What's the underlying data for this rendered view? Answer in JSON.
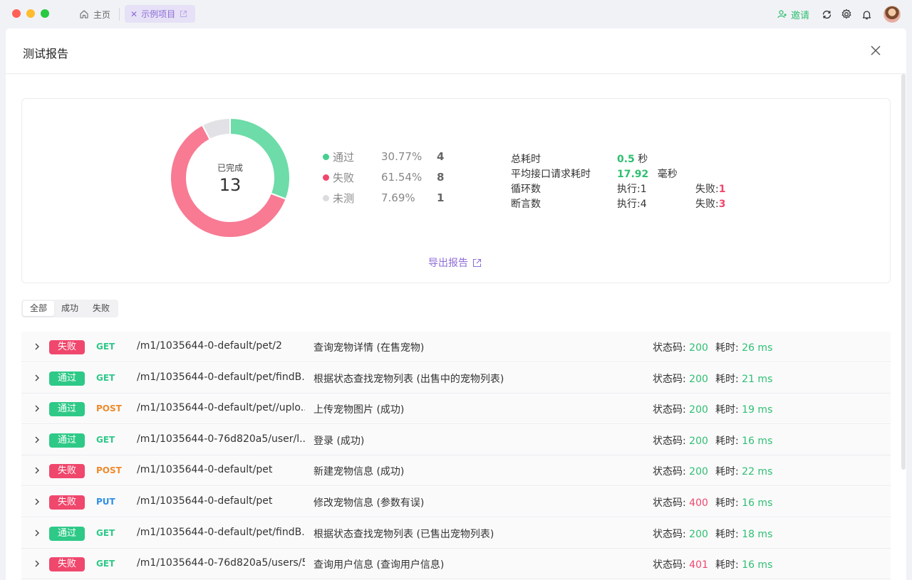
{
  "titlebar": {
    "tabs": [
      {
        "label": "主页",
        "icon": "home-icon"
      },
      {
        "label": "示例项目",
        "icon": "external-link-icon"
      }
    ],
    "invite_label": "邀请"
  },
  "report": {
    "title": "测试报告",
    "completed_label": "已完成",
    "completed_count": "13",
    "legend": [
      {
        "name": "通过",
        "pct": "30.77%",
        "count": "4",
        "color": "#6ddca8",
        "fraction": 0.3077
      },
      {
        "name": "失败",
        "pct": "61.54%",
        "count": "8",
        "color": "#f87a93",
        "fraction": 0.6154
      },
      {
        "name": "未测",
        "pct": "7.69%",
        "count": "1",
        "color": "#e2e2e6",
        "fraction": 0.0769
      }
    ],
    "stats": {
      "total_time_label": "总耗时",
      "total_time_value": "0.5",
      "total_time_unit": "秒",
      "avg_time_label": "平均接口请求耗时",
      "avg_time_value": "17.92",
      "avg_time_unit": "毫秒",
      "loops_label": "循环数",
      "loops_exec": "执行:1",
      "loops_fail_label": "失败:",
      "loops_fail_value": "1",
      "asserts_label": "断言数",
      "asserts_exec": "执行:4",
      "asserts_fail_label": "失败:",
      "asserts_fail_value": "3"
    },
    "export_label": "导出报告"
  },
  "filters": [
    "全部",
    "成功",
    "失败"
  ],
  "labels": {
    "status_code": "状态码: ",
    "time_cost": "耗时: "
  },
  "rows": [
    {
      "result": "失败",
      "type": "fail",
      "method": "GET",
      "path": "/m1/1035644-0-default/pet/2",
      "desc": "查询宠物详情 (在售宠物)",
      "code": "200",
      "code_ok": true,
      "time": "26 ms"
    },
    {
      "result": "通过",
      "type": "pass",
      "method": "GET",
      "path": "/m1/1035644-0-default/pet/findB...",
      "desc": "根据状态查找宠物列表 (出售中的宠物列表)",
      "code": "200",
      "code_ok": true,
      "time": "21 ms"
    },
    {
      "result": "通过",
      "type": "pass",
      "method": "POST",
      "path": "/m1/1035644-0-default/pet//uplo...",
      "desc": "上传宠物图片 (成功)",
      "code": "200",
      "code_ok": true,
      "time": "19 ms"
    },
    {
      "result": "通过",
      "type": "pass",
      "method": "GET",
      "path": "/m1/1035644-0-76d820a5/user/l...",
      "desc": "登录 (成功)",
      "code": "200",
      "code_ok": true,
      "time": "16 ms"
    },
    {
      "result": "失败",
      "type": "fail",
      "method": "POST",
      "path": "/m1/1035644-0-default/pet",
      "desc": "新建宠物信息 (成功)",
      "code": "200",
      "code_ok": true,
      "time": "22 ms"
    },
    {
      "result": "失败",
      "type": "fail",
      "method": "PUT",
      "path": "/m1/1035644-0-default/pet",
      "desc": "修改宠物信息 (参数有误)",
      "code": "400",
      "code_ok": false,
      "time": "16 ms"
    },
    {
      "result": "通过",
      "type": "pass",
      "method": "GET",
      "path": "/m1/1035644-0-default/pet/findB...",
      "desc": "根据状态查找宠物列表 (已售出宠物列表)",
      "code": "200",
      "code_ok": true,
      "time": "18 ms"
    },
    {
      "result": "失败",
      "type": "fail",
      "method": "GET",
      "path": "/m1/1035644-0-76d820a5/users/5",
      "desc": "查询用户信息 (查询用户信息)",
      "code": "401",
      "code_ok": false,
      "time": "16 ms"
    }
  ]
}
